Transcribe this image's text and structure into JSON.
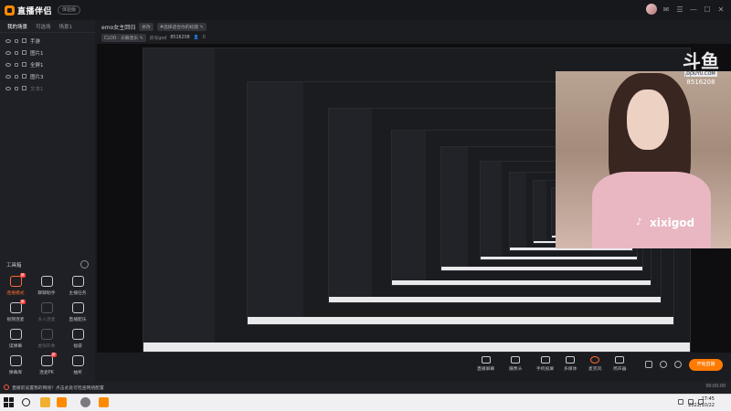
{
  "app": {
    "logo_text": "直播伴侣",
    "version_badge": "体验版"
  },
  "sidebar": {
    "scene_tabs": [
      "我的场景",
      "可选场",
      "场景1"
    ],
    "sources": [
      {
        "label": "手游",
        "dim": false
      },
      {
        "label": "图片1",
        "dim": false
      },
      {
        "label": "全屏1",
        "dim": false
      },
      {
        "label": "图片3",
        "dim": false
      },
      {
        "label": "文本1",
        "dim": true
      }
    ],
    "toolbox_title": "工具箱",
    "tools": [
      {
        "label": "连接模式",
        "style": "orange",
        "badge": "新"
      },
      {
        "label": "聊聊助手",
        "style": "normal",
        "badge": ""
      },
      {
        "label": "主播任务",
        "style": "normal",
        "badge": ""
      },
      {
        "label": "视频连麦",
        "style": "normal",
        "badge": "新"
      },
      {
        "label": "多人连麦",
        "style": "dim",
        "badge": ""
      },
      {
        "label": "直播配乐",
        "style": "normal",
        "badge": ""
      },
      {
        "label": "读弹幕",
        "style": "normal",
        "badge": ""
      },
      {
        "label": "虚拟形象",
        "style": "dim",
        "badge": ""
      },
      {
        "label": "福袋",
        "style": "normal",
        "badge": ""
      },
      {
        "label": "弹幕库",
        "style": "normal",
        "badge": ""
      },
      {
        "label": "连麦PK",
        "style": "normal",
        "badge": "新"
      },
      {
        "label": "抽奖",
        "style": "normal",
        "badge": ""
      }
    ]
  },
  "header": {
    "room_title": "emo女主回归",
    "edit_chip": "修改",
    "tag_chip": "#选择适合你的标题 ✎",
    "category_chip": "CLOO · 天籁音乐 ✎",
    "room_id_label": "房号god",
    "room_id_value": "8516208",
    "viewer_count": "0"
  },
  "preview": {
    "tiktok_name": "xixigod",
    "watermark_logo": "斗鱼",
    "watermark_sub": "DOUYU.COM",
    "watermark_id": "8516208"
  },
  "actions": [
    {
      "label": "直播屏幕",
      "icon": "monitor-icon"
    },
    {
      "label": "摄像头",
      "icon": "camera-icon"
    },
    {
      "label": "手机投屏",
      "icon": "phone-icon"
    },
    {
      "label": "多媒体",
      "icon": "media-icon"
    },
    {
      "label": "麦克风",
      "icon": "microphone-icon"
    },
    {
      "label": "扬声器",
      "icon": "speaker-icon"
    }
  ],
  "start_button": "开始直播",
  "status": {
    "text": "直播前设置我的网络？点击此处可检查网络配置",
    "time": "00:00:00"
  },
  "taskbar": {
    "time": "17:45",
    "date": "2022/10/22"
  },
  "colors": {
    "accent": "#ff7a00",
    "danger": "#ff3e3e"
  }
}
